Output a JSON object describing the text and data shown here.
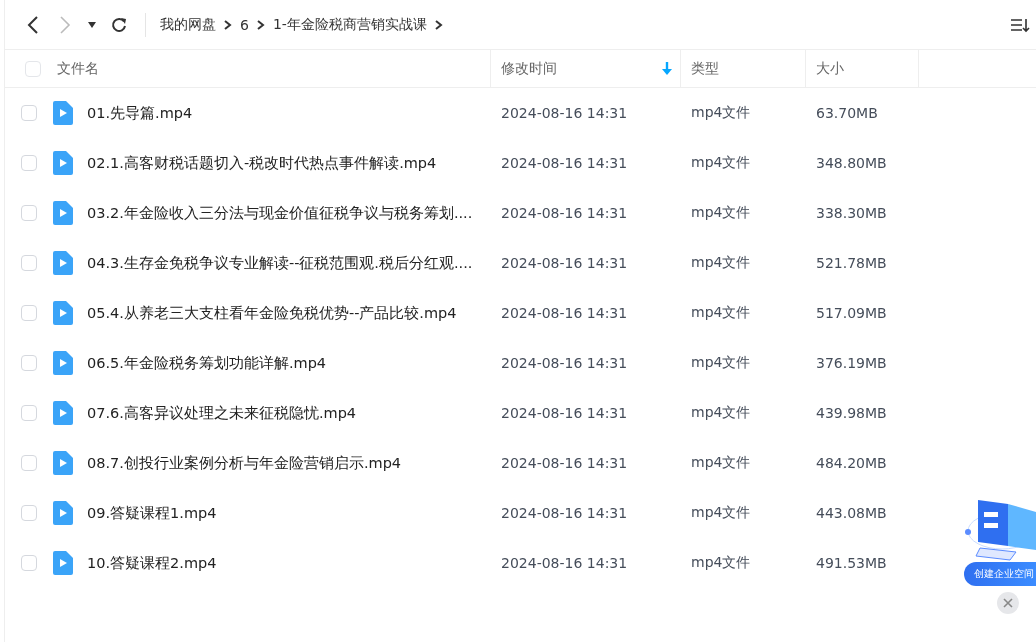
{
  "breadcrumb": [
    "我的网盘",
    "6",
    "1-年金险税商营销实战课"
  ],
  "table": {
    "columns": [
      {
        "label": "文件名",
        "sorted": false
      },
      {
        "label": "修改时间",
        "sorted": true
      },
      {
        "label": "类型",
        "sorted": false
      },
      {
        "label": "大小",
        "sorted": false
      }
    ],
    "select_all": {
      "selected": false
    },
    "rows": [
      {
        "name": "01.先导篇.mp4",
        "modified": "2024-08-16 14:31",
        "type": "mp4文件",
        "size": "63.70MB",
        "selected": false
      },
      {
        "name": "02.1.高客财税话题切入-税改时代热点事件解读.mp4",
        "modified": "2024-08-16 14:31",
        "type": "mp4文件",
        "size": "348.80MB",
        "selected": false
      },
      {
        "name": "03.2.年金险收入三分法与现金价值征税争议与税务筹划....",
        "modified": "2024-08-16 14:31",
        "type": "mp4文件",
        "size": "338.30MB",
        "selected": false
      },
      {
        "name": "04.3.生存金免税争议专业解读--征税范围观.税后分红观....",
        "modified": "2024-08-16 14:31",
        "type": "mp4文件",
        "size": "521.78MB",
        "selected": false
      },
      {
        "name": "05.4.从养老三大支柱看年金险免税优势--产品比较.mp4",
        "modified": "2024-08-16 14:31",
        "type": "mp4文件",
        "size": "517.09MB",
        "selected": false
      },
      {
        "name": "06.5.年金险税务筹划功能详解.mp4",
        "modified": "2024-08-16 14:31",
        "type": "mp4文件",
        "size": "376.19MB",
        "selected": false
      },
      {
        "name": "07.6.高客异议处理之未来征税隐忧.mp4",
        "modified": "2024-08-16 14:31",
        "type": "mp4文件",
        "size": "439.98MB",
        "selected": false
      },
      {
        "name": "08.7.创投行业案例分析与年金险营销启示.mp4",
        "modified": "2024-08-16 14:31",
        "type": "mp4文件",
        "size": "484.20MB",
        "selected": false
      },
      {
        "name": "09.答疑课程1.mp4",
        "modified": "2024-08-16 14:31",
        "type": "mp4文件",
        "size": "443.08MB",
        "selected": false
      },
      {
        "name": "10.答疑课程2.mp4",
        "modified": "2024-08-16 14:31",
        "type": "mp4文件",
        "size": "491.53MB",
        "selected": false
      }
    ]
  },
  "promo": {
    "label": "创建企业空间"
  }
}
